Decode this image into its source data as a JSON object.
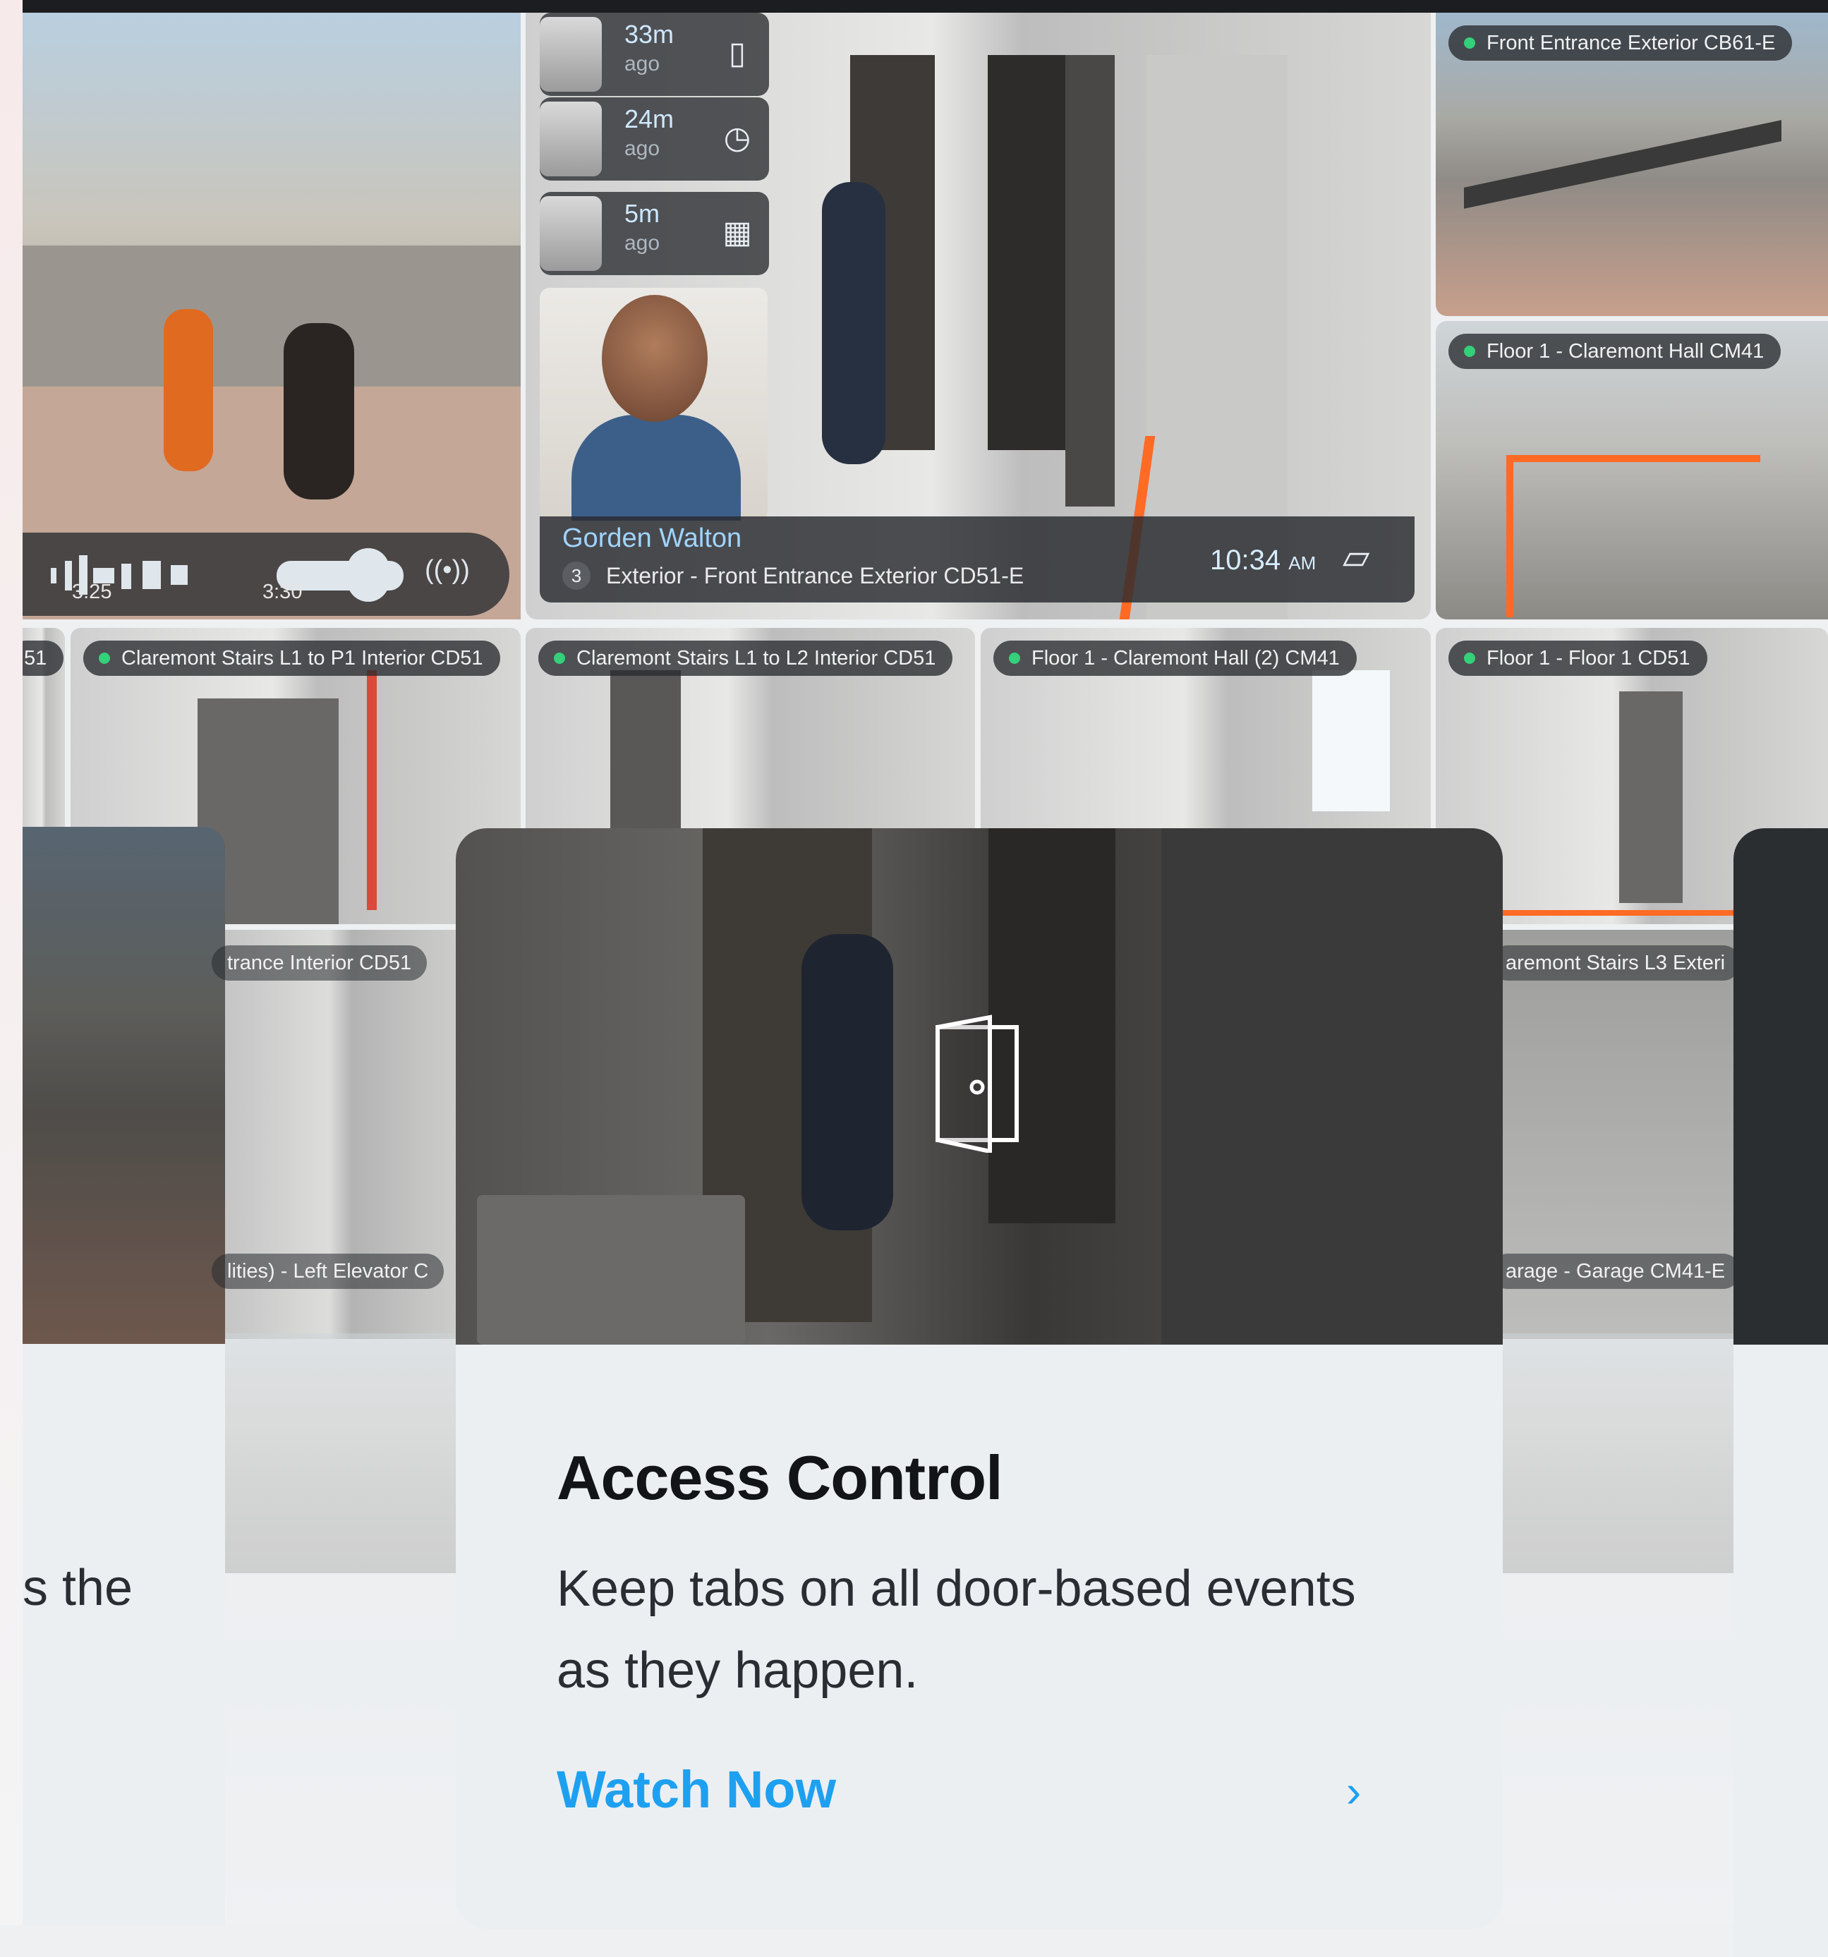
{
  "cameras": {
    "top_right_1": "Front Entrance Exterior CB61-E",
    "top_right_2": "Floor 1 - Claremont Hall CM41",
    "row2_partial": "51",
    "row2_1": "Claremont Stairs L1 to P1 Interior CD51",
    "row2_2": "Claremont Stairs L1 to L2 Interior CD51",
    "row2_3": "Floor 1 - Claremont Hall (2) CM41",
    "row2_4": "Floor 1 - Floor 1 CD51",
    "ghost_left_1": "trance Interior CD51",
    "ghost_left_2": "lities)  - Left Elevator C",
    "ghost_right_1": "aremont Stairs L3 Exteri",
    "ghost_right_2": "arage - Garage CM41-E"
  },
  "events": [
    {
      "time": "33m",
      "ago": "ago",
      "icon": "phone-icon"
    },
    {
      "time": "24m",
      "ago": "ago",
      "icon": "schedule-icon"
    },
    {
      "time": "5m",
      "ago": "ago",
      "icon": "keypad-icon"
    }
  ],
  "notice": {
    "name": "Gorden Walton",
    "badge": "3",
    "location": "Exterior - Front Entrance Exterior CD51-E",
    "time": "10:34",
    "ampm": "AM"
  },
  "audio": {
    "t1": "3:25",
    "t2": "3:30",
    "icon": "broadcast-icon"
  },
  "card": {
    "title": "Access Control",
    "description": "Keep tabs on all door-based events as they happen.",
    "link": "Watch Now",
    "link_arrow": "›"
  },
  "partial_text": "s the",
  "colors": {
    "accent": "#1ea0f0",
    "status_dot": "#34d07a",
    "stripe": "#ff6a24"
  }
}
